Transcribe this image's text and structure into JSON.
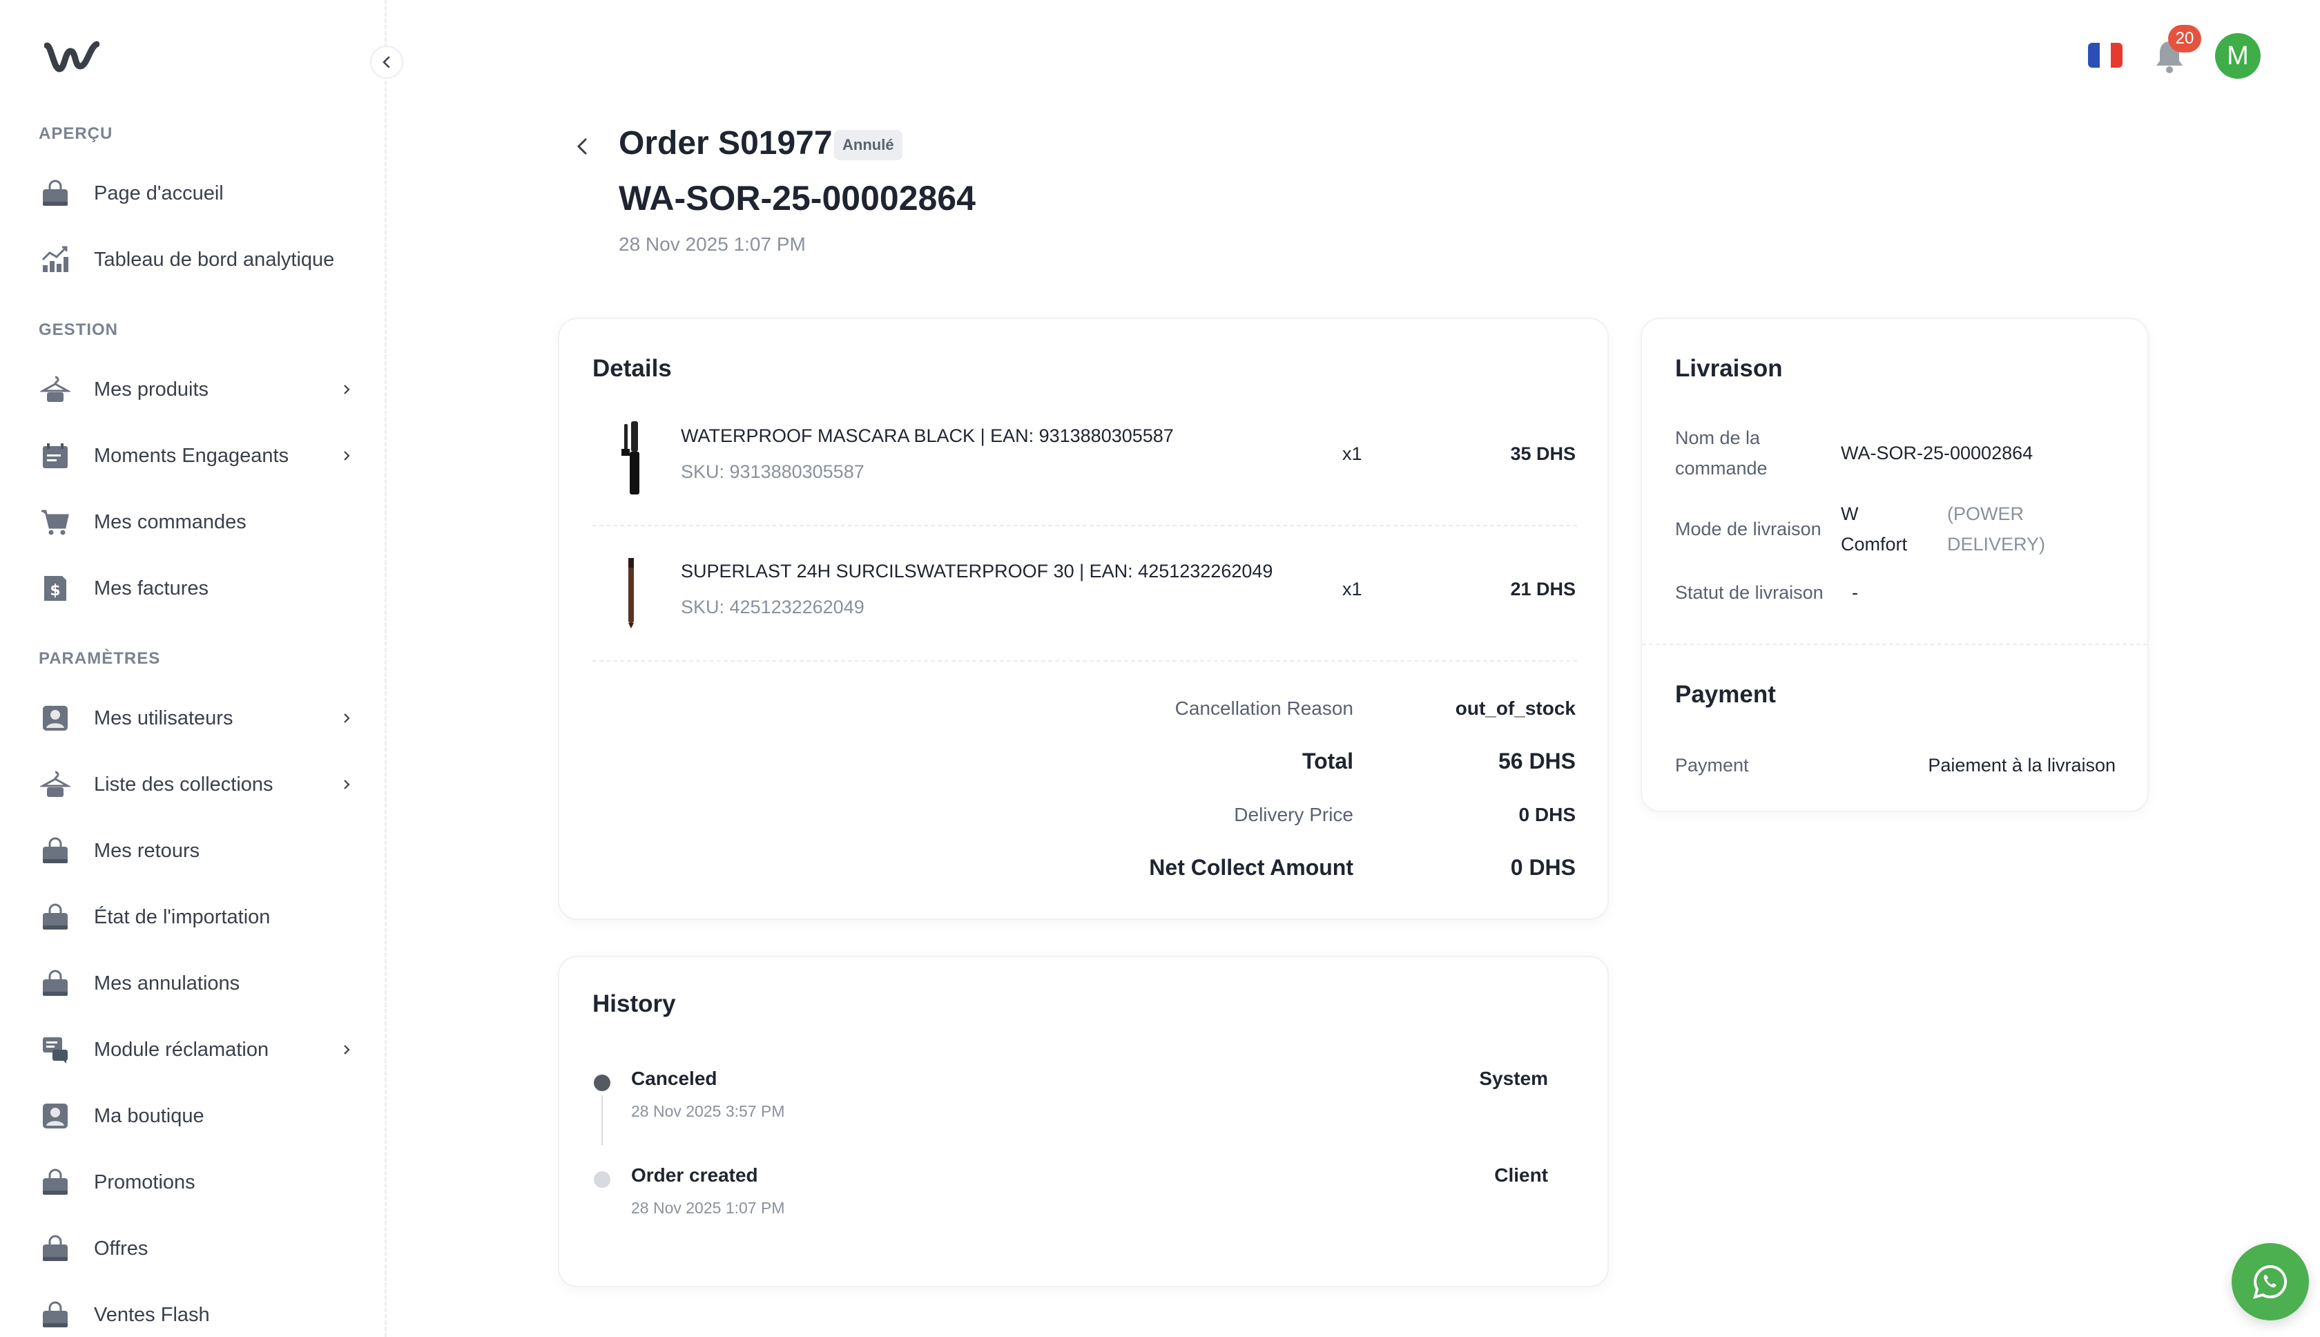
{
  "sidebar": {
    "sections": {
      "apercu": "APERÇU",
      "gestion": "GESTION",
      "parametres": "PARAMÈTRES"
    },
    "items": [
      {
        "label": "Page d'accueil",
        "icon": "bag-icon"
      },
      {
        "label": "Tableau de bord analytique",
        "icon": "analytics-icon"
      },
      {
        "label": "Mes produits",
        "icon": "hanger-icon"
      },
      {
        "label": "Moments Engageants",
        "icon": "calendar-icon"
      },
      {
        "label": "Mes commandes",
        "icon": "cart-icon"
      },
      {
        "label": "Mes factures",
        "icon": "invoice-icon"
      },
      {
        "label": "Mes utilisateurs",
        "icon": "user-icon"
      },
      {
        "label": "Liste des collections",
        "icon": "hanger-icon"
      },
      {
        "label": "Mes retours",
        "icon": "bag-icon"
      },
      {
        "label": "État de l'importation",
        "icon": "bag-icon"
      },
      {
        "label": "Mes annulations",
        "icon": "bag-icon"
      },
      {
        "label": "Module réclamation",
        "icon": "chat-icon"
      },
      {
        "label": "Ma boutique",
        "icon": "user-icon"
      },
      {
        "label": "Promotions",
        "icon": "bag-icon"
      },
      {
        "label": "Offres",
        "icon": "bag-icon"
      },
      {
        "label": "Ventes Flash",
        "icon": "bag-icon"
      }
    ]
  },
  "topbar": {
    "notification_count": "20",
    "avatar_initial": "M",
    "flag_colors": [
      "#2b4fb8",
      "#ffffff",
      "#e63a2e"
    ]
  },
  "order": {
    "title": "Order S01977",
    "status": "Annulé",
    "reference": "WA-SOR-25-00002864",
    "date": "28 Nov 2025 1:07 PM"
  },
  "details": {
    "title": "Details",
    "items": [
      {
        "name": "WATERPROOF MASCARA BLACK | EAN: 9313880305587",
        "sku": "SKU: 9313880305587",
        "qty": "x1",
        "price": "35 DHS"
      },
      {
        "name": "SUPERLAST 24H SURCILSWATERPROOF 30 | EAN: 4251232262049",
        "sku": "SKU: 4251232262049",
        "qty": "x1",
        "price": "21 DHS"
      }
    ],
    "summary": {
      "cancellation_label": "Cancellation Reason",
      "cancellation_value": "out_of_stock",
      "total_label": "Total",
      "total_value": "56 DHS",
      "delivery_label": "Delivery Price",
      "delivery_value": "0 DHS",
      "net_label": "Net Collect Amount",
      "net_value": "0 DHS"
    }
  },
  "history": {
    "title": "History",
    "events": [
      {
        "label": "Canceled",
        "date": "28 Nov 2025 3:57 PM",
        "actor": "System"
      },
      {
        "label": "Order created",
        "date": "28 Nov 2025 1:07 PM",
        "actor": "Client"
      }
    ]
  },
  "livraison": {
    "title": "Livraison",
    "order_name_label": "Nom de la commande",
    "order_name_value": "WA-SOR-25-00002864",
    "mode_label": "Mode de livraison",
    "mode_value": "W Comfort",
    "mode_extra": "(POWER DELIVERY)",
    "status_label": "Statut de livraison",
    "status_value": "-"
  },
  "payment": {
    "title": "Payment",
    "label": "Payment",
    "value": "Paiement à la livraison"
  },
  "colors": {
    "accent_green": "#3fae49",
    "badge_red": "#e5533e",
    "whatsapp_green": "#4caf50"
  }
}
